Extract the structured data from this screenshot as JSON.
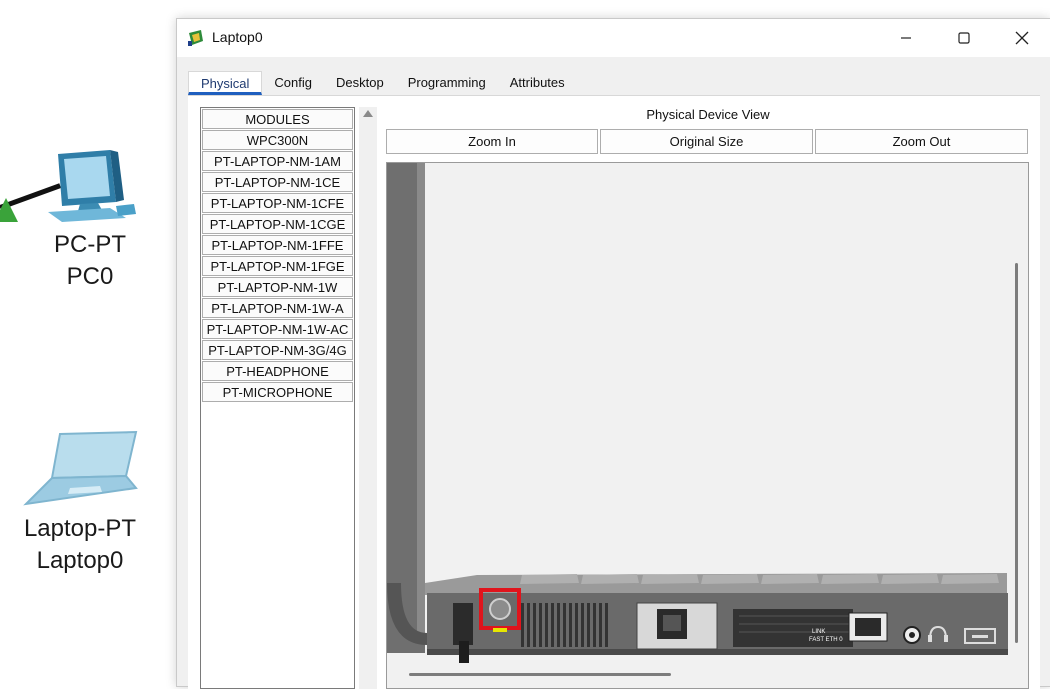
{
  "workspace": {
    "devices": [
      {
        "model": "PC-PT",
        "name": "PC0"
      },
      {
        "model": "Laptop-PT",
        "name": "Laptop0"
      }
    ]
  },
  "window": {
    "title": "Laptop0",
    "tabs": [
      "Physical",
      "Config",
      "Desktop",
      "Programming",
      "Attributes"
    ],
    "active_tab": "Physical"
  },
  "modules": {
    "items": [
      "MODULES",
      "WPC300N",
      "PT-LAPTOP-NM-1AM",
      "PT-LAPTOP-NM-1CE",
      "PT-LAPTOP-NM-1CFE",
      "PT-LAPTOP-NM-1CGE",
      "PT-LAPTOP-NM-1FFE",
      "PT-LAPTOP-NM-1FGE",
      "PT-LAPTOP-NM-1W",
      "PT-LAPTOP-NM-1W-A",
      "PT-LAPTOP-NM-1W-AC",
      "PT-LAPTOP-NM-3G/4G",
      "PT-HEADPHONE",
      "PT-MICROPHONE"
    ]
  },
  "physical_view": {
    "title": "Physical Device View",
    "zoom_in": "Zoom In",
    "original_size": "Original Size",
    "zoom_out": "Zoom Out",
    "port_label_1": "LINK",
    "port_label_2": "FAST ETH 0",
    "power_button_highlight_color": "#e0141c"
  },
  "icons": [
    "minimize-icon",
    "maximize-icon",
    "close-icon",
    "pc-icon",
    "laptop-icon",
    "app-icon",
    "headphone-icon",
    "scroll-up-icon"
  ]
}
